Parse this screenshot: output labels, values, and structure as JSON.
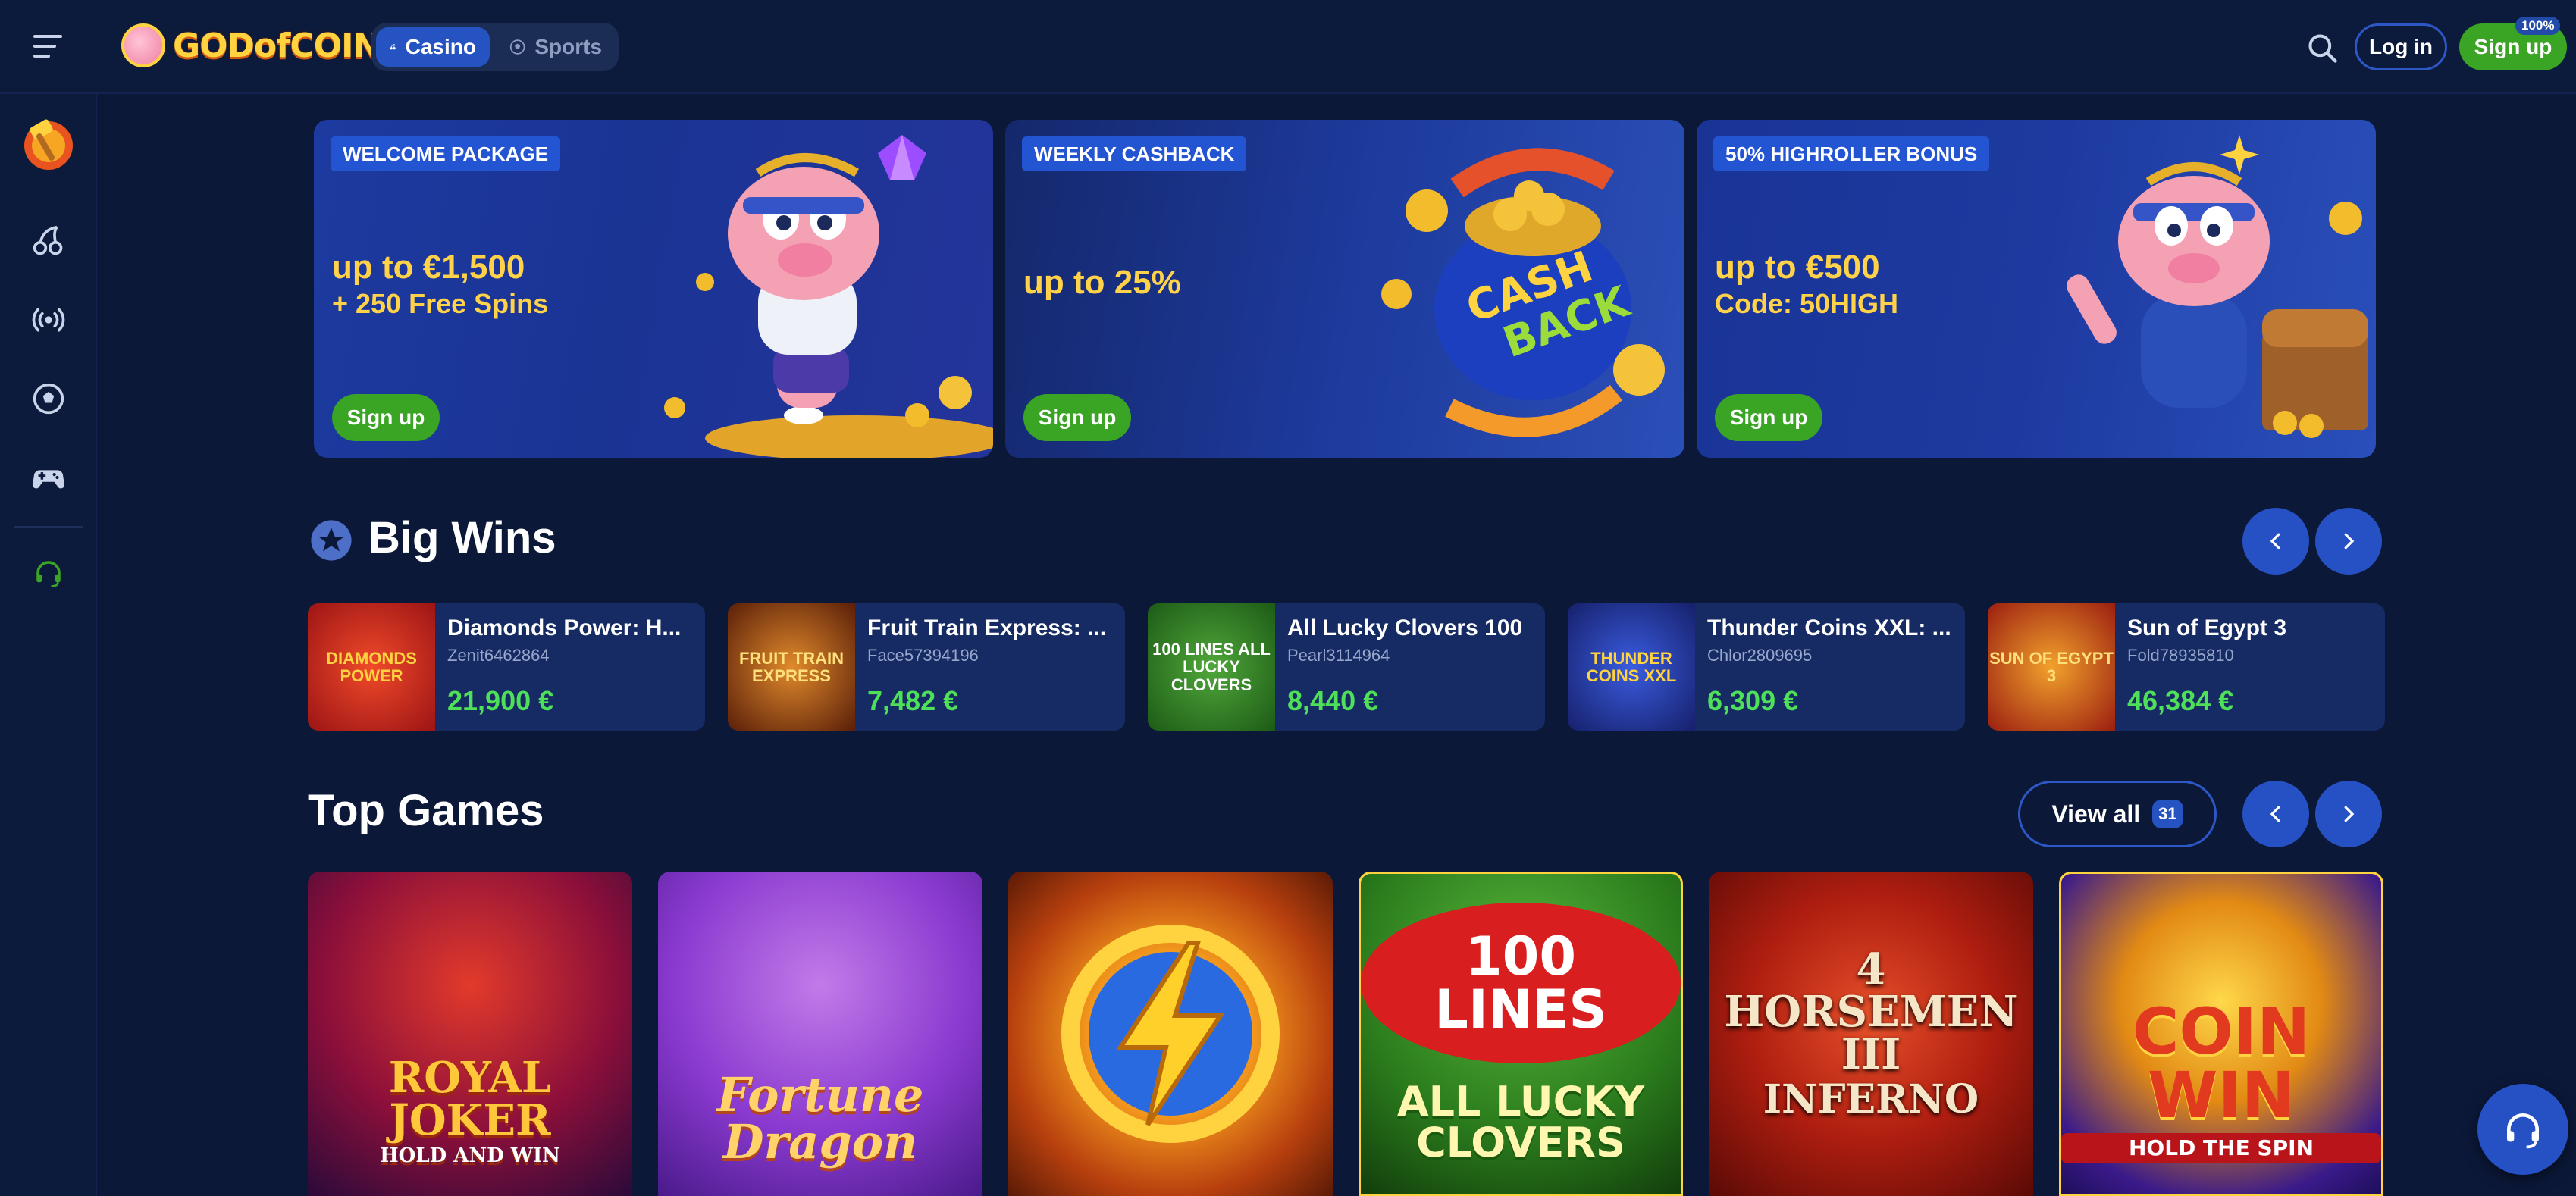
{
  "header": {
    "logo_text": "GODofCOINS",
    "modes": [
      {
        "label": "Casino",
        "active": true
      },
      {
        "label": "Sports",
        "active": false
      }
    ],
    "login_label": "Log in",
    "signup_label": "Sign up",
    "signup_badge": "100%"
  },
  "sidebar": {
    "items": [
      {
        "icon": "promo-hammer-icon"
      },
      {
        "icon": "cherries-icon"
      },
      {
        "icon": "live-broadcast-icon"
      },
      {
        "icon": "soccer-ball-icon"
      },
      {
        "icon": "gamepad-icon"
      },
      {
        "icon": "support-headset-icon"
      }
    ]
  },
  "promos": [
    {
      "tag": "WELCOME PACKAGE",
      "title": "up to €1,500",
      "subtitle": "+ 250 Free Spins",
      "button": "Sign up",
      "art": "pig-mascot-with-gem"
    },
    {
      "tag": "WEEKLY CASHBACK",
      "title": "up to 25%",
      "subtitle": "",
      "button": "Sign up",
      "art": "cashback-coin-bag"
    },
    {
      "tag": "50% HIGHROLLER BONUS",
      "title": "up to €500",
      "subtitle": "Code: 50HIGH",
      "button": "Sign up",
      "art": "pig-knight-treasure-chest"
    }
  ],
  "big_wins": {
    "title": "Big Wins",
    "items": [
      {
        "game": "Diamonds Power: H...",
        "user": "Zenit6462864",
        "amount": "21,900 €",
        "thumb_text": "DIAMONDS POWER"
      },
      {
        "game": "Fruit Train Express: ...",
        "user": "Face57394196",
        "amount": "7,482 €",
        "thumb_text": "FRUIT TRAIN EXPRESS"
      },
      {
        "game": "All Lucky Clovers 100",
        "user": "Pearl3114964",
        "amount": "8,440 €",
        "thumb_text": "100 LINES ALL LUCKY CLOVERS"
      },
      {
        "game": "Thunder Coins XXL: ...",
        "user": "Chlor2809695",
        "amount": "6,309 €",
        "thumb_text": "THUNDER COINS XXL"
      },
      {
        "game": "Sun of Egypt 3",
        "user": "Fold78935810",
        "amount": "46,384 €",
        "thumb_text": "SUN OF EGYPT 3"
      }
    ]
  },
  "top_games": {
    "title": "Top Games",
    "view_all_label": "View all",
    "view_all_count": "31",
    "items": [
      {
        "label": "ROYAL JOKER",
        "sub": "HOLD AND WIN"
      },
      {
        "label": "Fortune Dragon",
        "sub": ""
      },
      {
        "label": "",
        "sub": ""
      },
      {
        "label": "100 LINES",
        "sub": "ALL LUCKY CLOVERS"
      },
      {
        "label": "4 HORSEMEN III",
        "sub": "INFERNO"
      },
      {
        "label": "COIN WIN",
        "sub": "HOLD THE SPIN"
      }
    ]
  },
  "colors": {
    "background": "#0b1838",
    "accent_blue": "#2551c4",
    "signup_green": "#3aa424",
    "promo_yellow": "#ffd24a",
    "win_green": "#4fe05a"
  }
}
